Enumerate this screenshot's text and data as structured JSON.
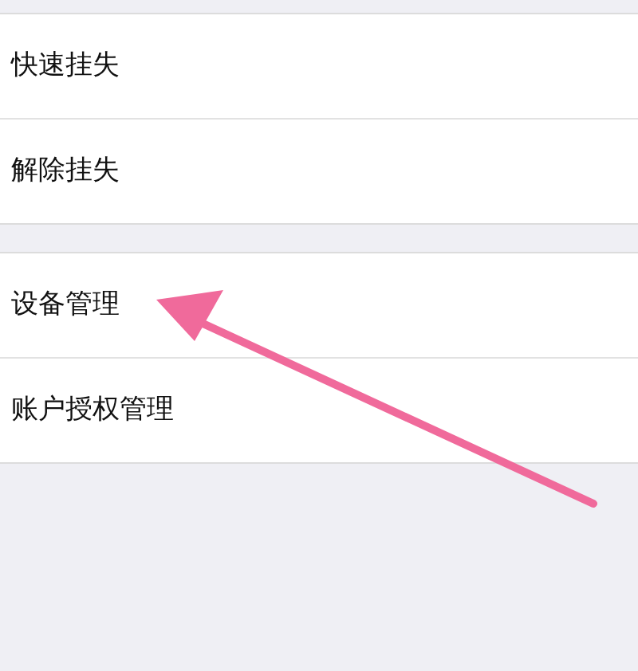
{
  "groups": [
    {
      "items": [
        {
          "label": "快速挂失"
        },
        {
          "label": "解除挂失"
        }
      ]
    },
    {
      "items": [
        {
          "label": "设备管理"
        },
        {
          "label": "账户授权管理"
        }
      ]
    }
  ]
}
